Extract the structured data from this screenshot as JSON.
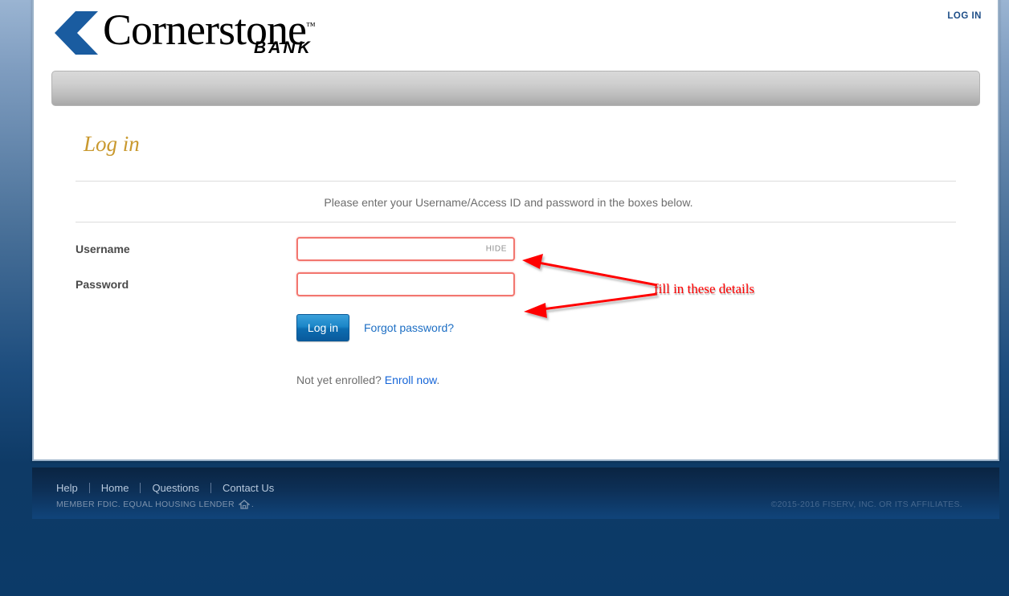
{
  "header": {
    "logo_word": "Cornerstone",
    "logo_tm": "™",
    "logo_sub": "BANK",
    "logo_icon": "chevron-logo-mark",
    "login_link": "LOG IN"
  },
  "main": {
    "page_title": "Log in",
    "instruction": "Please enter your Username/Access ID and password in the boxes below.",
    "fields": [
      {
        "label": "Username",
        "value": "",
        "placeholder": "",
        "toggle": "HIDE",
        "type": "text"
      },
      {
        "label": "Password",
        "value": "",
        "placeholder": "",
        "toggle": "",
        "type": "password"
      }
    ],
    "login_button": "Log in",
    "forgot_link": "Forgot password?",
    "enroll_prefix": "Not yet enrolled? ",
    "enroll_link": "Enroll now",
    "enroll_suffix": "."
  },
  "footer": {
    "links": [
      "Help",
      "Home",
      "Questions",
      "Contact Us"
    ],
    "legal": "MEMBER FDIC. EQUAL HOUSING LENDER",
    "legal_suffix": ".",
    "house_icon": "equal-housing-lender-icon",
    "copyright": "©2015-2016 FISERV, INC. OR ITS AFFILIATES."
  },
  "annotation": {
    "text": "fill in these details",
    "color": "#ff0000",
    "arrow_count": 2
  },
  "colors": {
    "accent_blue": "#1a5ca0",
    "title_gold": "#c9992f",
    "link_blue": "#1565d8",
    "field_highlight": "#f2766f",
    "footer_bg": "#0d3057"
  }
}
